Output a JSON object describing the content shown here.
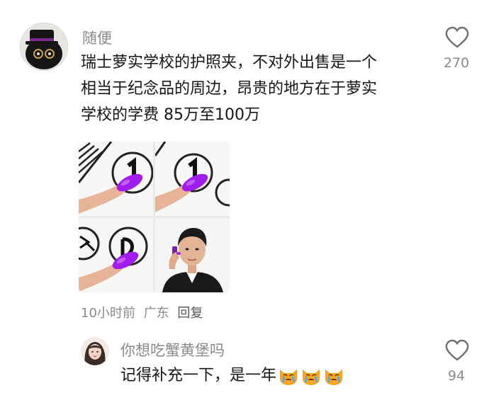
{
  "comment1": {
    "username": "随便",
    "text_lines": [
      "瑞士萝实学校的护照夹，不对外出售是一个",
      "相当于纪念品的周边，昂贵的地方在于萝实",
      "学校的学费 85万至100万"
    ],
    "likes": "270",
    "meta": {
      "time": "10小时前",
      "location": "广东",
      "reply_label": "回复"
    }
  },
  "comment2": {
    "username": "你想吃蟹黄堡吗",
    "text": "记得补充一下，是一年",
    "likes": "94",
    "emoji_icons": [
      "crying-cat-emoji",
      "crying-cat-emoji",
      "crying-cat-emoji"
    ]
  },
  "colors": {
    "nail_purple": "#a21cf0",
    "secondary_text": "#8a8a8a",
    "primary_text": "#161616"
  }
}
